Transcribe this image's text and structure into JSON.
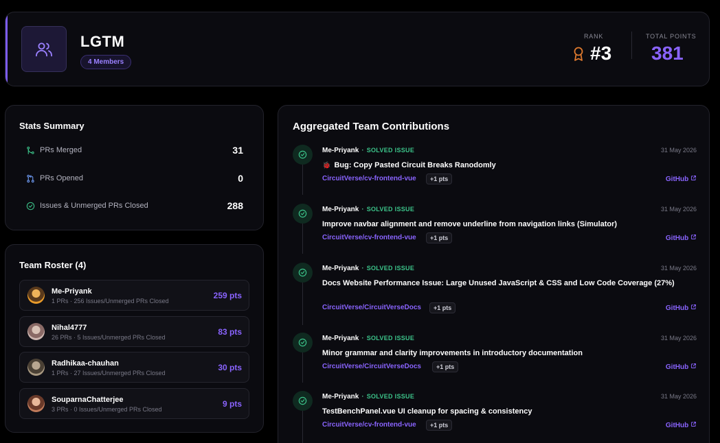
{
  "header": {
    "team_name": "LGTM",
    "members_badge": "4 Members",
    "rank_label": "RANK",
    "rank_value": "#3",
    "points_label": "TOTAL POINTS",
    "points_value": "381",
    "icons": {
      "team": "users-icon",
      "rank": "award-ribbon-icon"
    },
    "colors": {
      "accent": "#7c5cf0",
      "points": "#8a64ff",
      "rank_icon": "#e07a2e"
    }
  },
  "stats": {
    "title": "Stats Summary",
    "rows": [
      {
        "label": "PRs Merged",
        "value": "31",
        "icon": "git-merge-icon"
      },
      {
        "label": "PRs Opened",
        "value": "0",
        "icon": "git-pull-request-icon"
      },
      {
        "label": "Issues & Unmerged PRs Closed",
        "value": "288",
        "icon": "check-circle-icon"
      }
    ]
  },
  "roster": {
    "title": "Team Roster (4)",
    "members": [
      {
        "name": "Me-Priyank",
        "sub": "1 PRs · 256 Issues/Unmerged PRs Closed",
        "pts": "259 pts"
      },
      {
        "name": "Nihal4777",
        "sub": "26 PRs · 5 Issues/Unmerged PRs Closed",
        "pts": "83 pts"
      },
      {
        "name": "Radhikaa-chauhan",
        "sub": "1 PRs · 27 Issues/Unmerged PRs Closed",
        "pts": "30 pts"
      },
      {
        "name": "SouparnaChatterjee",
        "sub": "3 PRs · 0 Issues/Unmerged PRs Closed",
        "pts": "9 pts"
      }
    ]
  },
  "contributions": {
    "title": "Aggregated Team Contributions",
    "entries": [
      {
        "user": "Me-Priyank",
        "kind": "SOLVED ISSUE",
        "date": "31 May 2026",
        "title_prefix": "🐞",
        "title": "Bug: Copy Pasted Circuit Breaks Ranodomly",
        "repo": "CircuitVerse/cv-frontend-vue",
        "pts": "+1 pts",
        "link": "GitHub"
      },
      {
        "user": "Me-Priyank",
        "kind": "SOLVED ISSUE",
        "date": "31 May 2026",
        "title": "Improve navbar alignment and remove underline from navigation links (Simulator)",
        "repo": "CircuitVerse/cv-frontend-vue",
        "pts": "+1 pts",
        "link": "GitHub"
      },
      {
        "user": "Me-Priyank",
        "kind": "SOLVED ISSUE",
        "date": "31 May 2026",
        "title": "Docs Website Performance Issue: Large Unused JavaScript & CSS and Low Code Coverage (27%)",
        "repo": "CircuitVerse/CircuitVerseDocs",
        "pts": "+1 pts",
        "link": "GitHub"
      },
      {
        "user": "Me-Priyank",
        "kind": "SOLVED ISSUE",
        "date": "31 May 2026",
        "title": "Minor grammar and clarity improvements in introductory documentation",
        "repo": "CircuitVerse/CircuitVerseDocs",
        "pts": "+1 pts",
        "link": "GitHub"
      },
      {
        "user": "Me-Priyank",
        "kind": "SOLVED ISSUE",
        "date": "31 May 2026",
        "title": "TestBenchPanel.vue UI cleanup for spacing & consistency",
        "repo": "CircuitVerse/cv-frontend-vue",
        "pts": "+1 pts",
        "link": "GitHub"
      }
    ]
  }
}
